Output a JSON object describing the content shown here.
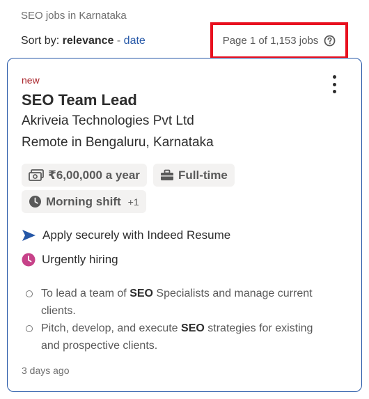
{
  "breadcrumb": "SEO jobs in Karnataka",
  "sort": {
    "label": "Sort by:",
    "active": "relevance",
    "separator": "-",
    "alternate": "date"
  },
  "pagination": {
    "text": "Page 1 of 1,153 jobs",
    "help_icon": "question-circle-icon"
  },
  "job": {
    "tag": "new",
    "title": "SEO Team Lead",
    "company": "Akriveia Technologies Pvt Ltd",
    "location": "Remote in Bengaluru, Karnataka",
    "chips": [
      {
        "icon": "money-icon",
        "label": "₹6,00,000 a year"
      },
      {
        "icon": "briefcase-icon",
        "label": "Full-time"
      },
      {
        "icon": "clock-icon",
        "label": "Morning shift",
        "extra": "+1"
      }
    ],
    "features": [
      {
        "icon": "send-arrow-icon",
        "label": "Apply securely with Indeed Resume"
      },
      {
        "icon": "urgent-clock-icon",
        "label": "Urgently hiring"
      }
    ],
    "snippet": [
      {
        "pre": "To lead a team of ",
        "bold": "SEO",
        "post": " Specialists and manage current clients."
      },
      {
        "pre": "Pitch, develop, and execute ",
        "bold": "SEO",
        "post": " strategies for existing and prospective clients."
      }
    ],
    "posted": "3 days ago"
  },
  "colors": {
    "link": "#2557a7",
    "new_tag": "#a9252b",
    "highlight_box": "#e8101f",
    "urgent": "#c74289",
    "send_arrow": "#2557a7"
  }
}
